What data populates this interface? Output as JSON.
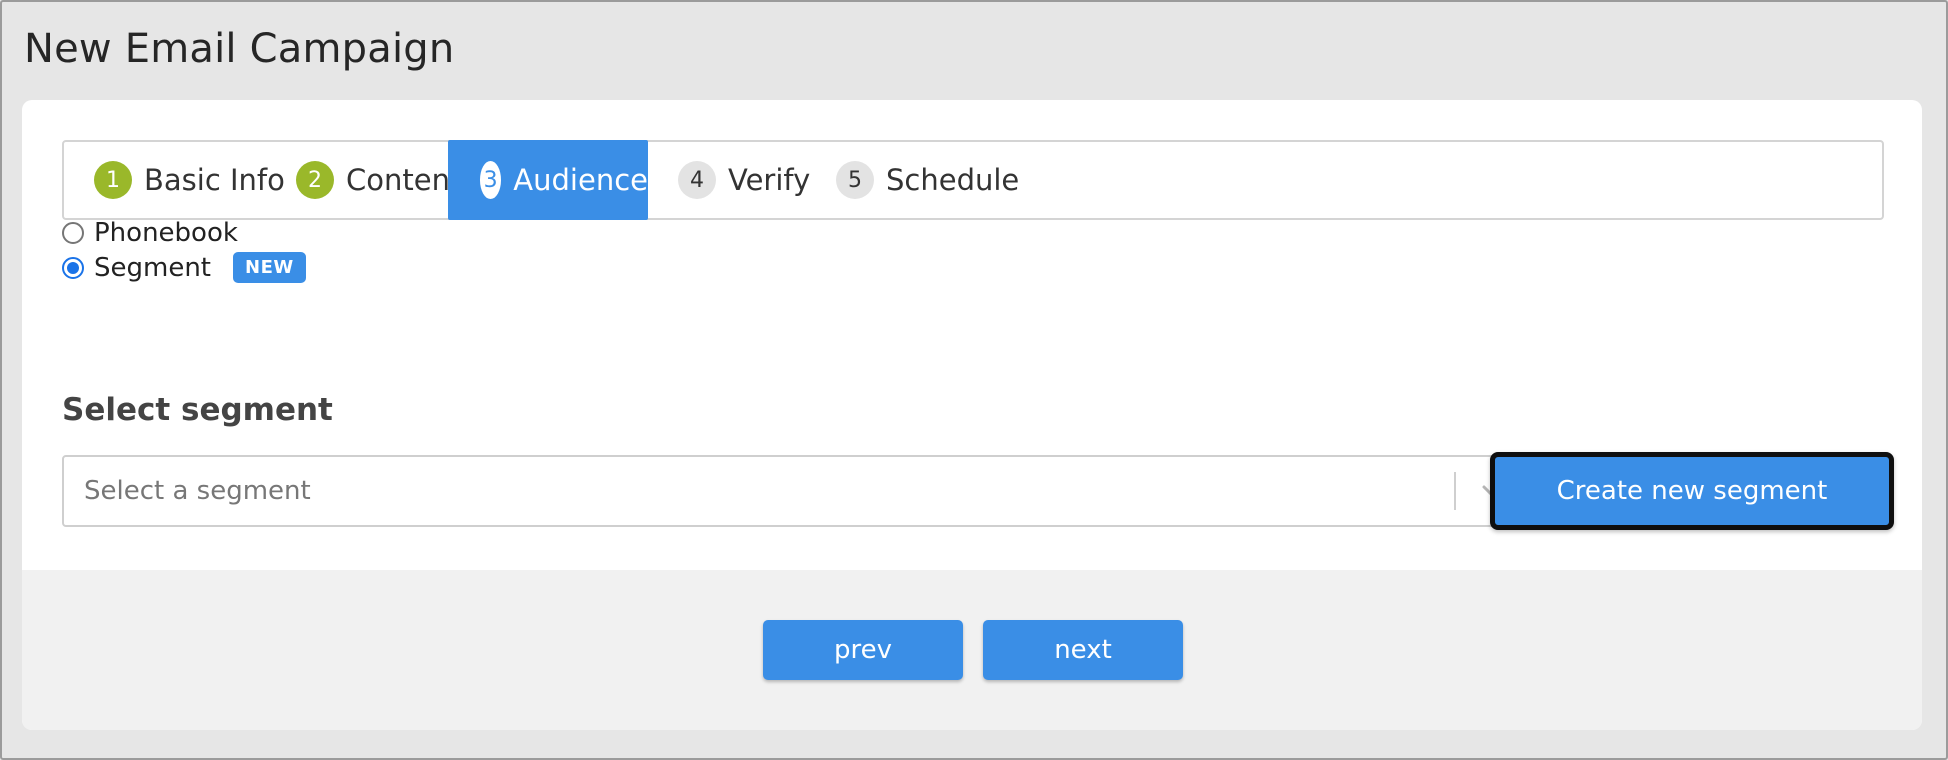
{
  "page": {
    "title": "New Email Campaign"
  },
  "steps": [
    {
      "number": "1",
      "label": "Basic Info",
      "state": "done"
    },
    {
      "number": "2",
      "label": "Content",
      "state": "done"
    },
    {
      "number": "3",
      "label": "Audience",
      "state": "active"
    },
    {
      "number": "4",
      "label": "Verify",
      "state": "todo"
    },
    {
      "number": "5",
      "label": "Schedule",
      "state": "todo"
    }
  ],
  "audience": {
    "options": [
      {
        "label": "Phonebook",
        "selected": false
      },
      {
        "label": "Segment",
        "selected": true,
        "badge": "NEW"
      }
    ]
  },
  "segment": {
    "heading": "Select segment",
    "placeholder": "Select a segment",
    "create_label": "Create new segment"
  },
  "footer": {
    "prev_label": "prev",
    "next_label": "next"
  },
  "colors": {
    "accent": "#3a8ee6",
    "done": "#9ab82a",
    "footer_bg": "#f1f1f1"
  },
  "icons": {
    "dropdown": "chevron-down-icon"
  }
}
